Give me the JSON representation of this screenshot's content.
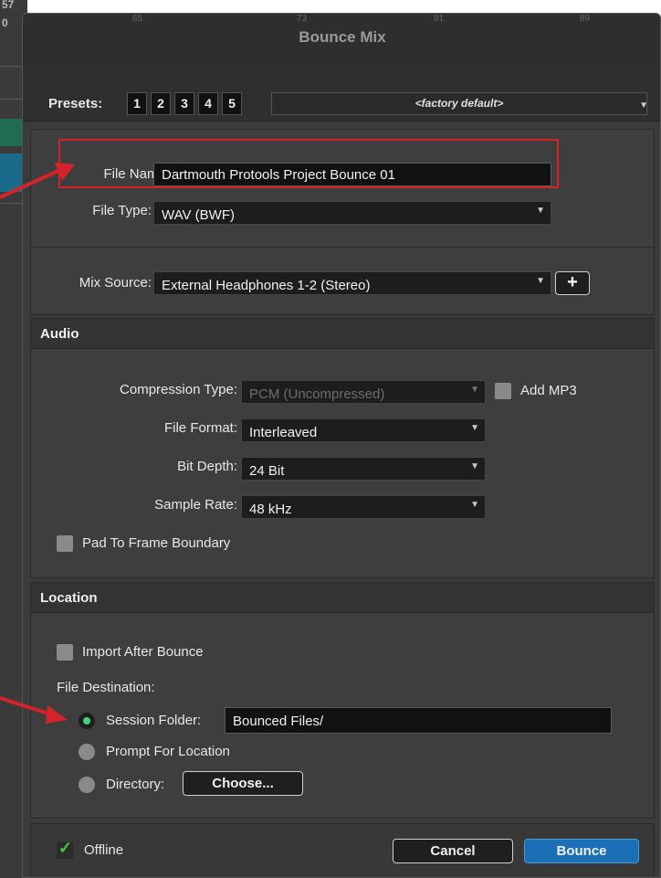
{
  "background": {
    "numbers": [
      "57",
      "0"
    ],
    "ticks": [
      "65",
      "73",
      "81",
      "89"
    ]
  },
  "dialog": {
    "title": "Bounce Mix"
  },
  "presets": {
    "label": "Presets:",
    "buttons": [
      "1",
      "2",
      "3",
      "4",
      "5"
    ],
    "selected": "<factory default>"
  },
  "file": {
    "name_label": "File Name:",
    "name_value": "Dartmouth Protools Project Bounce 01",
    "type_label": "File Type:",
    "type_value": "WAV (BWF)",
    "mix_source_label": "Mix Source:",
    "mix_source_value": "External Headphones 1-2 (Stereo)",
    "add_label": "+"
  },
  "audio": {
    "header": "Audio",
    "compression_label": "Compression Type:",
    "compression_value": "PCM (Uncompressed)",
    "add_mp3_label": "Add MP3",
    "add_mp3_checked": false,
    "format_label": "File Format:",
    "format_value": "Interleaved",
    "bit_depth_label": "Bit Depth:",
    "bit_depth_value": "24 Bit",
    "sample_rate_label": "Sample Rate:",
    "sample_rate_value": "48 kHz",
    "pad_label": "Pad To Frame Boundary",
    "pad_checked": false
  },
  "location": {
    "header": "Location",
    "import_label": "Import After Bounce",
    "import_checked": false,
    "destination_label": "File Destination:",
    "session_folder_label": "Session Folder:",
    "session_folder_value": "Bounced Files/",
    "prompt_label": "Prompt For Location",
    "directory_label": "Directory:",
    "choose_label": "Choose...",
    "selected_option": "Session Folder:"
  },
  "footer": {
    "offline_label": "Offline",
    "offline_checked": true,
    "cancel_label": "Cancel",
    "bounce_label": "Bounce"
  },
  "colors": {
    "accent_blue": "#1a6fb5",
    "highlight_red": "#d4232b",
    "radio_green": "#3fd47a",
    "check_green": "#3ccf3c"
  }
}
